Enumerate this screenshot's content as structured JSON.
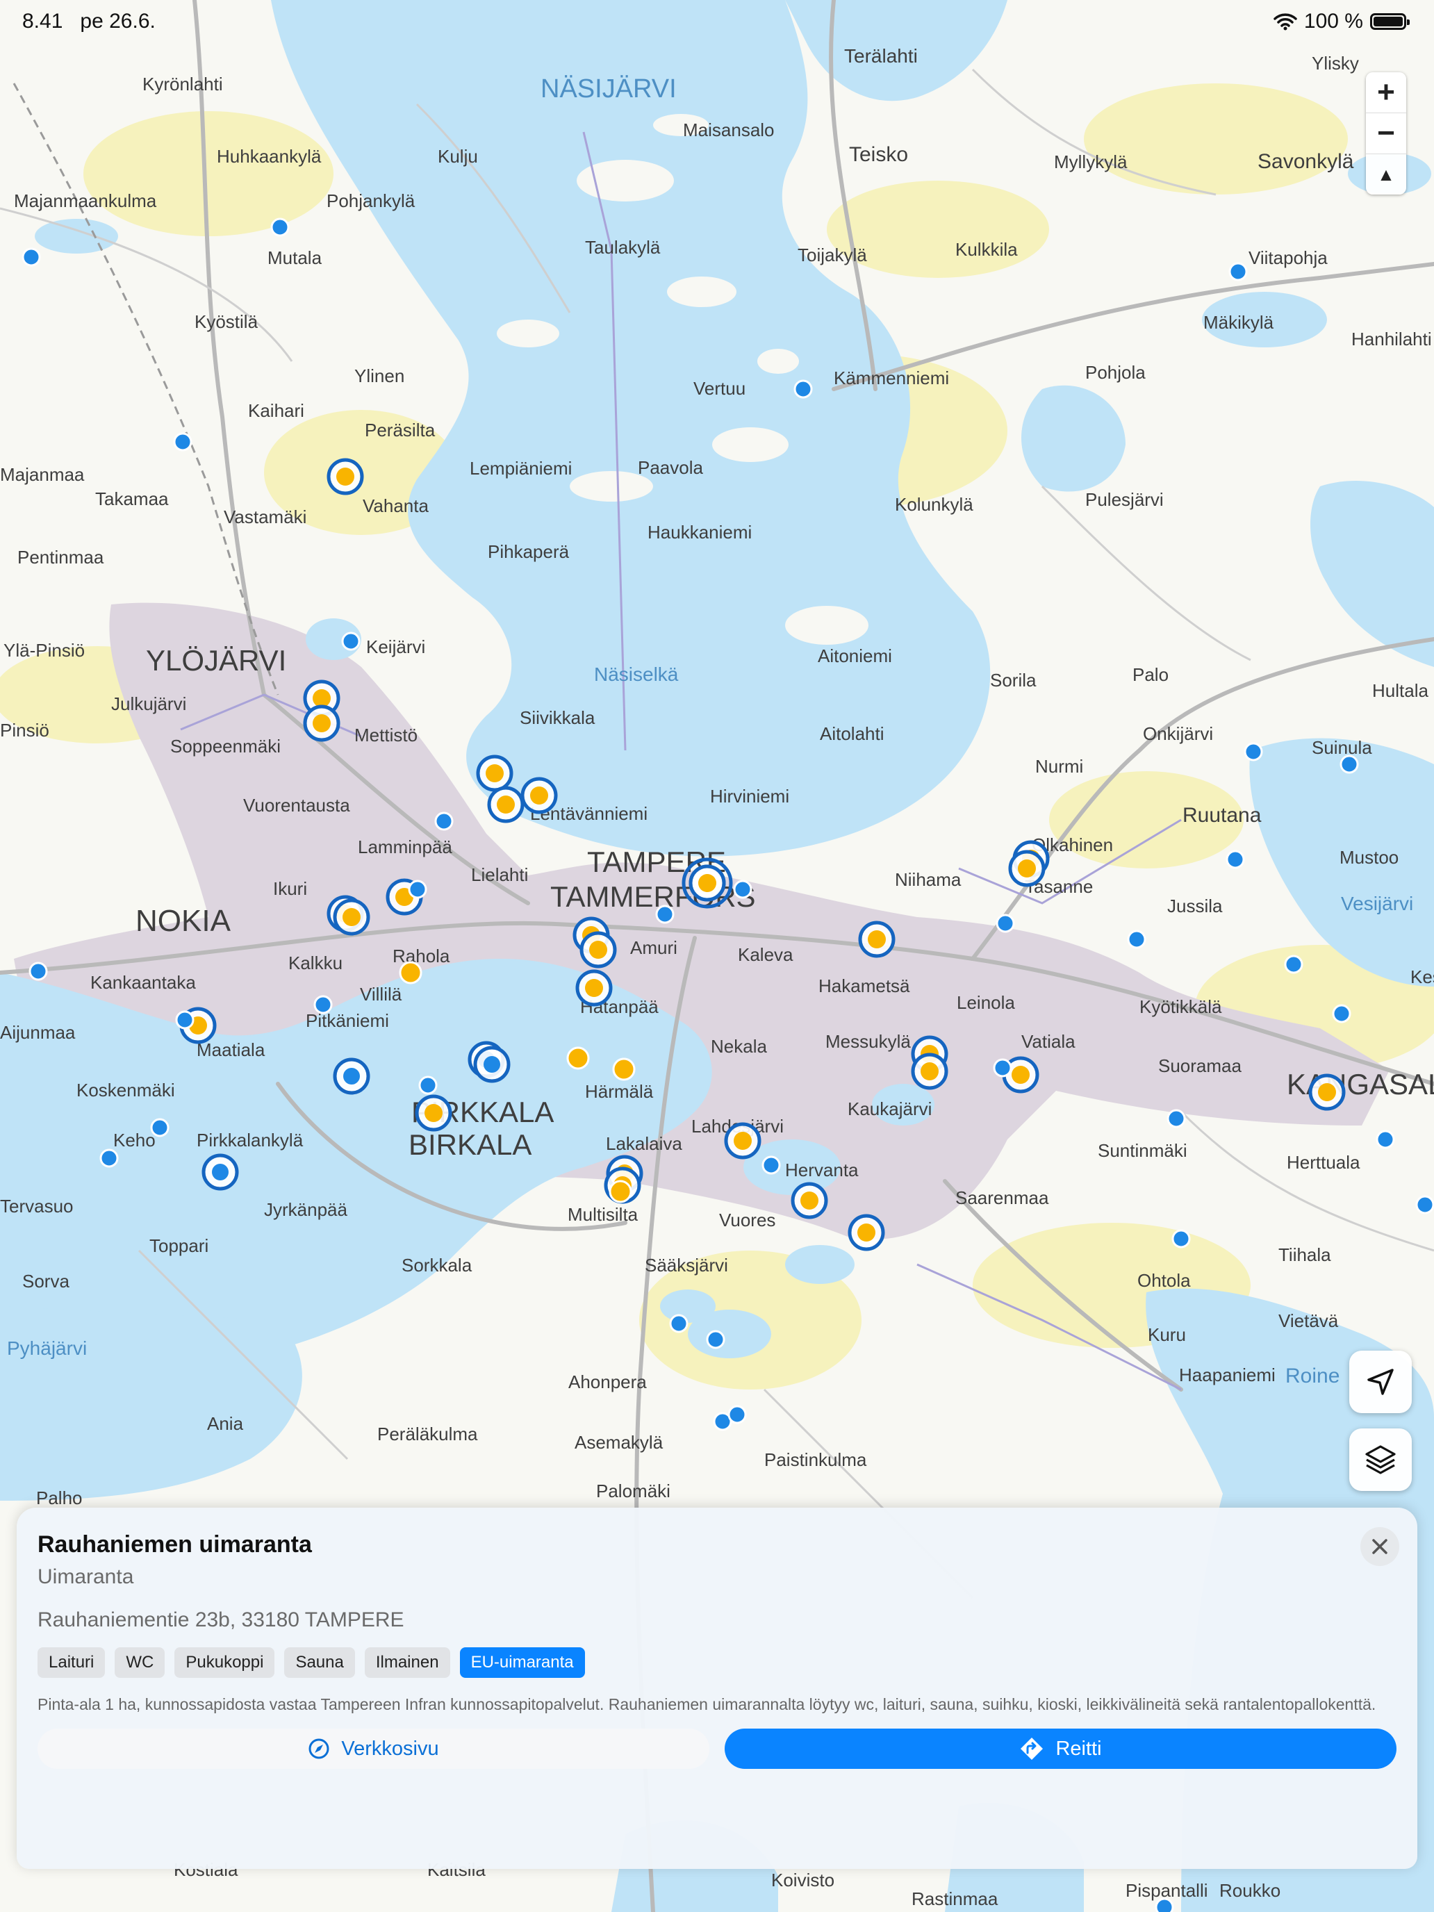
{
  "status_bar": {
    "time": "8.41",
    "date": "pe 26.6.",
    "battery": "100 %"
  },
  "map": {
    "water_labels": [
      {
        "name": "NÄSIJÄRVI"
      },
      {
        "name": "Näsiselkä"
      },
      {
        "name": "Vesijärvi"
      },
      {
        "name": "Pyhäjärvi"
      },
      {
        "name": "Roine"
      }
    ],
    "city_labels": [
      {
        "name": "YLÖJÄRVI"
      },
      {
        "name": "NOKIA"
      },
      {
        "name": "TAMPERE"
      },
      {
        "name": "TAMMERFORS"
      },
      {
        "name": "PIRKKALA"
      },
      {
        "name": "BIRKALA"
      },
      {
        "name": "KANGASALA"
      }
    ],
    "place_labels": [
      {
        "name": "Kyrönlahti"
      },
      {
        "name": "Huhkaankylä"
      },
      {
        "name": "Kulju"
      },
      {
        "name": "Pohjankylä"
      },
      {
        "name": "Majanmaankulma"
      },
      {
        "name": "Mutala"
      },
      {
        "name": "Kyöstilä"
      },
      {
        "name": "Ylinen"
      },
      {
        "name": "Kaihari"
      },
      {
        "name": "Peräsilta"
      },
      {
        "name": "Lempiäniemi"
      },
      {
        "name": "Paavola"
      },
      {
        "name": "Vahanta"
      },
      {
        "name": "Takamaa"
      },
      {
        "name": "Vastamäki"
      },
      {
        "name": "Pentinmaa"
      },
      {
        "name": "Pihkaperä"
      },
      {
        "name": "Haukkaniemi"
      },
      {
        "name": "Keijärvi"
      },
      {
        "name": "Ylä-Pinsiö"
      },
      {
        "name": "Julkujärvi"
      },
      {
        "name": "Soppeenmäki"
      },
      {
        "name": "Mettistö"
      },
      {
        "name": "Siivikkala"
      },
      {
        "name": "Vuorentausta"
      },
      {
        "name": "Lentävänniemi"
      },
      {
        "name": "Lamminpää"
      },
      {
        "name": "Lielahti"
      },
      {
        "name": "Ikuri"
      },
      {
        "name": "Rahola"
      },
      {
        "name": "Kalkku"
      },
      {
        "name": "Villilä"
      },
      {
        "name": "Pitkäniemi"
      },
      {
        "name": "Kankaantaka"
      },
      {
        "name": "Maatiala"
      },
      {
        "name": "Koskenmäki"
      },
      {
        "name": "Keho"
      },
      {
        "name": "Pirkkalankylä"
      },
      {
        "name": "Jyrkänpää"
      },
      {
        "name": "Tervasuo"
      },
      {
        "name": "Toppari"
      },
      {
        "name": "Sorva"
      },
      {
        "name": "Sorkkala"
      },
      {
        "name": "Peräläkulma"
      },
      {
        "name": "Ania"
      },
      {
        "name": "Palho"
      },
      {
        "name": "Asemakylä"
      },
      {
        "name": "Ahonpera"
      },
      {
        "name": "Palomäki"
      },
      {
        "name": "Paistinkulma"
      },
      {
        "name": "Sääksjärvi"
      },
      {
        "name": "Multisilta"
      },
      {
        "name": "Lakalaiva"
      },
      {
        "name": "Härmälä"
      },
      {
        "name": "Hatanpää"
      },
      {
        "name": "Amuri"
      },
      {
        "name": "Kaleva"
      },
      {
        "name": "Hakametsä"
      },
      {
        "name": "Nekala"
      },
      {
        "name": "Messukylä"
      },
      {
        "name": "Leinola"
      },
      {
        "name": "Vatiala"
      },
      {
        "name": "Kaukajärvi"
      },
      {
        "name": "Hervanta"
      },
      {
        "name": "Vuores"
      },
      {
        "name": "Lahdesjärvi"
      },
      {
        "name": "Saarenmaa"
      },
      {
        "name": "Niihama"
      },
      {
        "name": "Tasanne"
      },
      {
        "name": "Olkahinen"
      },
      {
        "name": "Jussila"
      },
      {
        "name": "Ruutana"
      },
      {
        "name": "Mustoo"
      },
      {
        "name": "Nurmi"
      },
      {
        "name": "Onkijärvi"
      },
      {
        "name": "Suinula"
      },
      {
        "name": "Palo"
      },
      {
        "name": "Sorila"
      },
      {
        "name": "Aitolahti"
      },
      {
        "name": "Aitoniemi"
      },
      {
        "name": "Hirviniemi"
      },
      {
        "name": "Pulesjärvi"
      },
      {
        "name": "Kolunkylä"
      },
      {
        "name": "Pohjola"
      },
      {
        "name": "Kämmenniemi"
      },
      {
        "name": "Vertuu"
      },
      {
        "name": "Mäkikylä"
      },
      {
        "name": "Hanhilahti"
      },
      {
        "name": "Viitapohja"
      },
      {
        "name": "Kulkkila"
      },
      {
        "name": "Toijakylä"
      },
      {
        "name": "Taulakylä"
      },
      {
        "name": "Teisko"
      },
      {
        "name": "Myllykylä"
      },
      {
        "name": "Savonkylä"
      },
      {
        "name": "Maisansalo"
      },
      {
        "name": "Terälahti"
      },
      {
        "name": "Ylisky"
      },
      {
        "name": "Kyötikkälä"
      },
      {
        "name": "Suoramaa"
      },
      {
        "name": "Suntinmäki"
      },
      {
        "name": "Herttuala"
      },
      {
        "name": "Tiihala"
      },
      {
        "name": "Ohtola"
      },
      {
        "name": "Kuru"
      },
      {
        "name": "Vietävä"
      },
      {
        "name": "Haapaniemi"
      },
      {
        "name": "Kostiala"
      },
      {
        "name": "Kaitsila"
      },
      {
        "name": "Koivisto"
      },
      {
        "name": "Pispantalli"
      },
      {
        "name": "Roukko"
      },
      {
        "name": "Rastinmaa"
      },
      {
        "name": "Kesk"
      },
      {
        "name": "Hultala"
      },
      {
        "name": "Aijunmaa"
      },
      {
        "name": "Pinsiö"
      },
      {
        "name": "Majanmaa"
      }
    ]
  },
  "zoom": {
    "in": "+",
    "out": "−",
    "north": "▲"
  },
  "sheet": {
    "title": "Rauhaniemen uimaranta",
    "subtitle": "Uimaranta",
    "address": "Rauhaniementie 23b, 33180 TAMPERE",
    "tags": [
      "Laituri",
      "WC",
      "Pukukoppi",
      "Sauna",
      "Ilmainen"
    ],
    "eu_tag": "EU-uimaranta",
    "description": "Pinta-ala 1 ha, kunnossapidosta vastaa Tampereen Infran kunnossapitopalvelut. Rauhaniemen uimarannalta löytyy wc, laituri, sauna, suihku, kioski, leikkivälineitä sekä rantalentopallokenttä.",
    "web_button": "Verkkosivu",
    "route_button": "Reitti"
  },
  "colors": {
    "accent": "#0a84ff",
    "water": "#bfe3f7",
    "urban": "#ddd5df",
    "marker_yellow": "#f9b400",
    "marker_blue": "#1e88e5"
  },
  "icons": [
    "wifi-icon",
    "battery-icon",
    "zoom-in-icon",
    "zoom-out-icon",
    "compass-icon",
    "locate-icon",
    "layers-icon",
    "close-icon",
    "compass-nav-icon",
    "route-sign-icon"
  ]
}
